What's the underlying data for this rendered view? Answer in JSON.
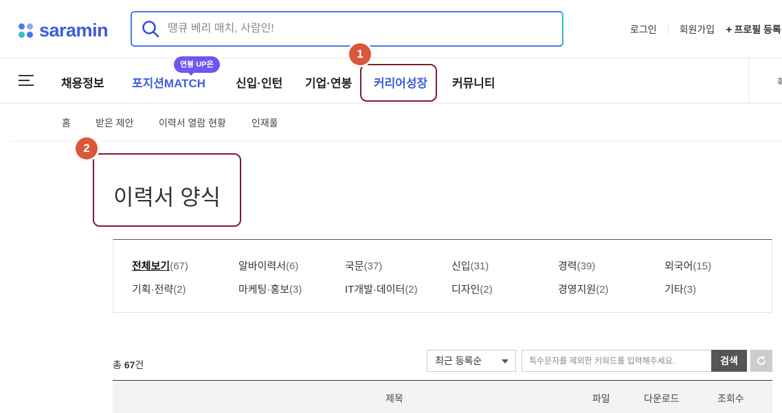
{
  "header": {
    "logo_text": "saramin",
    "search_placeholder": "땡큐 베리 매치, 사람인!",
    "links": {
      "login": "로그인",
      "signup": "회원가입",
      "profile": "프로필 등록"
    }
  },
  "gnb": {
    "items": [
      "채용정보",
      "포지션MATCH",
      "신입·인턴",
      "기업·연봉",
      "커리어성장",
      "커뮤니티"
    ],
    "badge": "연봉 UP은",
    "right_text": "확"
  },
  "subnav": {
    "items": [
      "홈",
      "받은 제안",
      "이력서 열람 현황",
      "인재풀"
    ]
  },
  "annotations": [
    "1",
    "2"
  ],
  "page": {
    "title": "이력서 양식"
  },
  "categories": [
    {
      "name": "전체보기",
      "count": "(67)",
      "active": true
    },
    {
      "name": "알바이력서",
      "count": "(6)"
    },
    {
      "name": "국문",
      "count": "(37)"
    },
    {
      "name": "신입",
      "count": "(31)"
    },
    {
      "name": "경력",
      "count": "(39)"
    },
    {
      "name": "외국어",
      "count": "(15)"
    },
    {
      "name": "기획·전략",
      "count": "(2)"
    },
    {
      "name": "마케팅·홍보",
      "count": "(3)"
    },
    {
      "name": "IT개발·데이터",
      "count": "(2)"
    },
    {
      "name": "디자인",
      "count": "(2)"
    },
    {
      "name": "경영지원",
      "count": "(2)"
    },
    {
      "name": "기타",
      "count": "(3)"
    }
  ],
  "list": {
    "total_prefix": "총 ",
    "total_count": "67",
    "total_suffix": "건",
    "sort_selected": "최근 등록순",
    "keyword_placeholder": "특수문자를 제외한 키워드를 입력해주세요.",
    "search_button": "검색",
    "columns": [
      "제목",
      "파일",
      "다운로드",
      "조회수"
    ]
  },
  "colors": {
    "brand": "#3d5ddb",
    "badge": "#6e56ef",
    "annotation": "#d9573a",
    "annotation_box": "#7a1b2e"
  }
}
